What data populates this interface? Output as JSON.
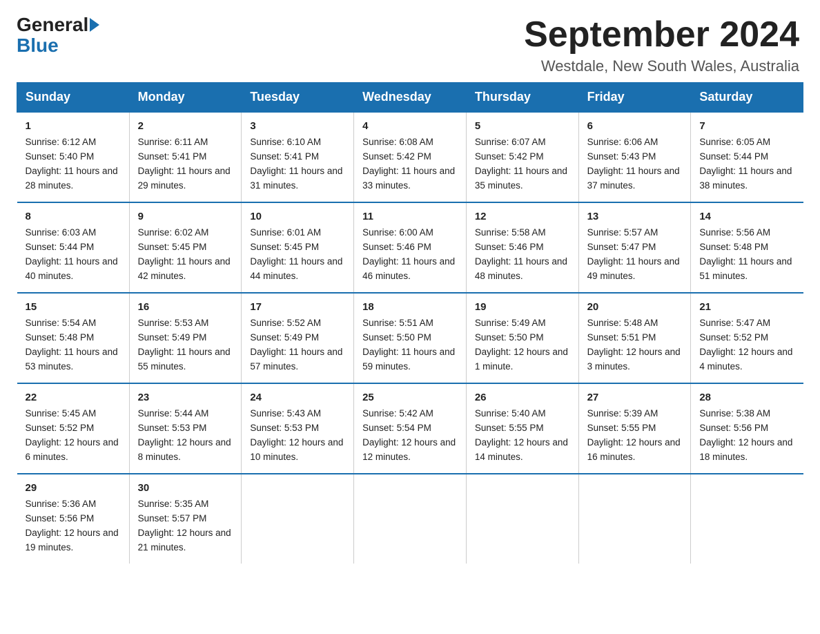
{
  "logo": {
    "general": "General",
    "blue": "Blue"
  },
  "header": {
    "month": "September 2024",
    "location": "Westdale, New South Wales, Australia"
  },
  "weekdays": [
    "Sunday",
    "Monday",
    "Tuesday",
    "Wednesday",
    "Thursday",
    "Friday",
    "Saturday"
  ],
  "weeks": [
    [
      {
        "day": "1",
        "sunrise": "6:12 AM",
        "sunset": "5:40 PM",
        "daylight": "11 hours and 28 minutes."
      },
      {
        "day": "2",
        "sunrise": "6:11 AM",
        "sunset": "5:41 PM",
        "daylight": "11 hours and 29 minutes."
      },
      {
        "day": "3",
        "sunrise": "6:10 AM",
        "sunset": "5:41 PM",
        "daylight": "11 hours and 31 minutes."
      },
      {
        "day": "4",
        "sunrise": "6:08 AM",
        "sunset": "5:42 PM",
        "daylight": "11 hours and 33 minutes."
      },
      {
        "day": "5",
        "sunrise": "6:07 AM",
        "sunset": "5:42 PM",
        "daylight": "11 hours and 35 minutes."
      },
      {
        "day": "6",
        "sunrise": "6:06 AM",
        "sunset": "5:43 PM",
        "daylight": "11 hours and 37 minutes."
      },
      {
        "day": "7",
        "sunrise": "6:05 AM",
        "sunset": "5:44 PM",
        "daylight": "11 hours and 38 minutes."
      }
    ],
    [
      {
        "day": "8",
        "sunrise": "6:03 AM",
        "sunset": "5:44 PM",
        "daylight": "11 hours and 40 minutes."
      },
      {
        "day": "9",
        "sunrise": "6:02 AM",
        "sunset": "5:45 PM",
        "daylight": "11 hours and 42 minutes."
      },
      {
        "day": "10",
        "sunrise": "6:01 AM",
        "sunset": "5:45 PM",
        "daylight": "11 hours and 44 minutes."
      },
      {
        "day": "11",
        "sunrise": "6:00 AM",
        "sunset": "5:46 PM",
        "daylight": "11 hours and 46 minutes."
      },
      {
        "day": "12",
        "sunrise": "5:58 AM",
        "sunset": "5:46 PM",
        "daylight": "11 hours and 48 minutes."
      },
      {
        "day": "13",
        "sunrise": "5:57 AM",
        "sunset": "5:47 PM",
        "daylight": "11 hours and 49 minutes."
      },
      {
        "day": "14",
        "sunrise": "5:56 AM",
        "sunset": "5:48 PM",
        "daylight": "11 hours and 51 minutes."
      }
    ],
    [
      {
        "day": "15",
        "sunrise": "5:54 AM",
        "sunset": "5:48 PM",
        "daylight": "11 hours and 53 minutes."
      },
      {
        "day": "16",
        "sunrise": "5:53 AM",
        "sunset": "5:49 PM",
        "daylight": "11 hours and 55 minutes."
      },
      {
        "day": "17",
        "sunrise": "5:52 AM",
        "sunset": "5:49 PM",
        "daylight": "11 hours and 57 minutes."
      },
      {
        "day": "18",
        "sunrise": "5:51 AM",
        "sunset": "5:50 PM",
        "daylight": "11 hours and 59 minutes."
      },
      {
        "day": "19",
        "sunrise": "5:49 AM",
        "sunset": "5:50 PM",
        "daylight": "12 hours and 1 minute."
      },
      {
        "day": "20",
        "sunrise": "5:48 AM",
        "sunset": "5:51 PM",
        "daylight": "12 hours and 3 minutes."
      },
      {
        "day": "21",
        "sunrise": "5:47 AM",
        "sunset": "5:52 PM",
        "daylight": "12 hours and 4 minutes."
      }
    ],
    [
      {
        "day": "22",
        "sunrise": "5:45 AM",
        "sunset": "5:52 PM",
        "daylight": "12 hours and 6 minutes."
      },
      {
        "day": "23",
        "sunrise": "5:44 AM",
        "sunset": "5:53 PM",
        "daylight": "12 hours and 8 minutes."
      },
      {
        "day": "24",
        "sunrise": "5:43 AM",
        "sunset": "5:53 PM",
        "daylight": "12 hours and 10 minutes."
      },
      {
        "day": "25",
        "sunrise": "5:42 AM",
        "sunset": "5:54 PM",
        "daylight": "12 hours and 12 minutes."
      },
      {
        "day": "26",
        "sunrise": "5:40 AM",
        "sunset": "5:55 PM",
        "daylight": "12 hours and 14 minutes."
      },
      {
        "day": "27",
        "sunrise": "5:39 AM",
        "sunset": "5:55 PM",
        "daylight": "12 hours and 16 minutes."
      },
      {
        "day": "28",
        "sunrise": "5:38 AM",
        "sunset": "5:56 PM",
        "daylight": "12 hours and 18 minutes."
      }
    ],
    [
      {
        "day": "29",
        "sunrise": "5:36 AM",
        "sunset": "5:56 PM",
        "daylight": "12 hours and 19 minutes."
      },
      {
        "day": "30",
        "sunrise": "5:35 AM",
        "sunset": "5:57 PM",
        "daylight": "12 hours and 21 minutes."
      },
      null,
      null,
      null,
      null,
      null
    ]
  ],
  "labels": {
    "sunrise": "Sunrise: ",
    "sunset": "Sunset: ",
    "daylight": "Daylight: "
  }
}
